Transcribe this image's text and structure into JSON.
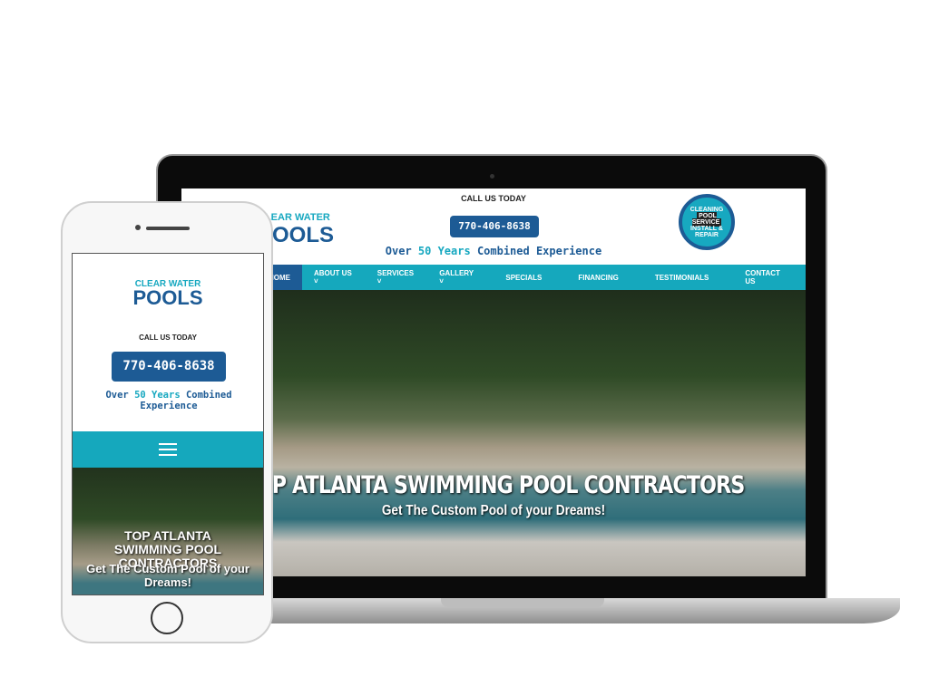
{
  "site": {
    "logo_top": "CLEAR WATER",
    "logo_bottom": "POOLS",
    "call_label": "CALL US TODAY",
    "phone": "770-406-8638",
    "experience_pre": "Over",
    "experience_highlight": "50 Years",
    "experience_post": "Combined Experience",
    "badge": {
      "top": "CLEANING",
      "middle": "POOL SERVICE",
      "bottom": "INSTALL & REPAIR"
    },
    "nav": [
      "HOME",
      "ABOUT US ˅",
      "SERVICES ˅",
      "GALLERY ˅",
      "SPECIALS",
      "FINANCING",
      "TESTIMONIALS",
      "CONTACT US"
    ],
    "hero_title": "TOP ATLANTA SWIMMING POOL CONTRACTORS",
    "hero_subtitle": "Get The Custom Pool of your Dreams!"
  },
  "colors": {
    "teal": "#15a8bd",
    "navy": "#1d5b95"
  },
  "icons": [
    "menu-icon"
  ]
}
